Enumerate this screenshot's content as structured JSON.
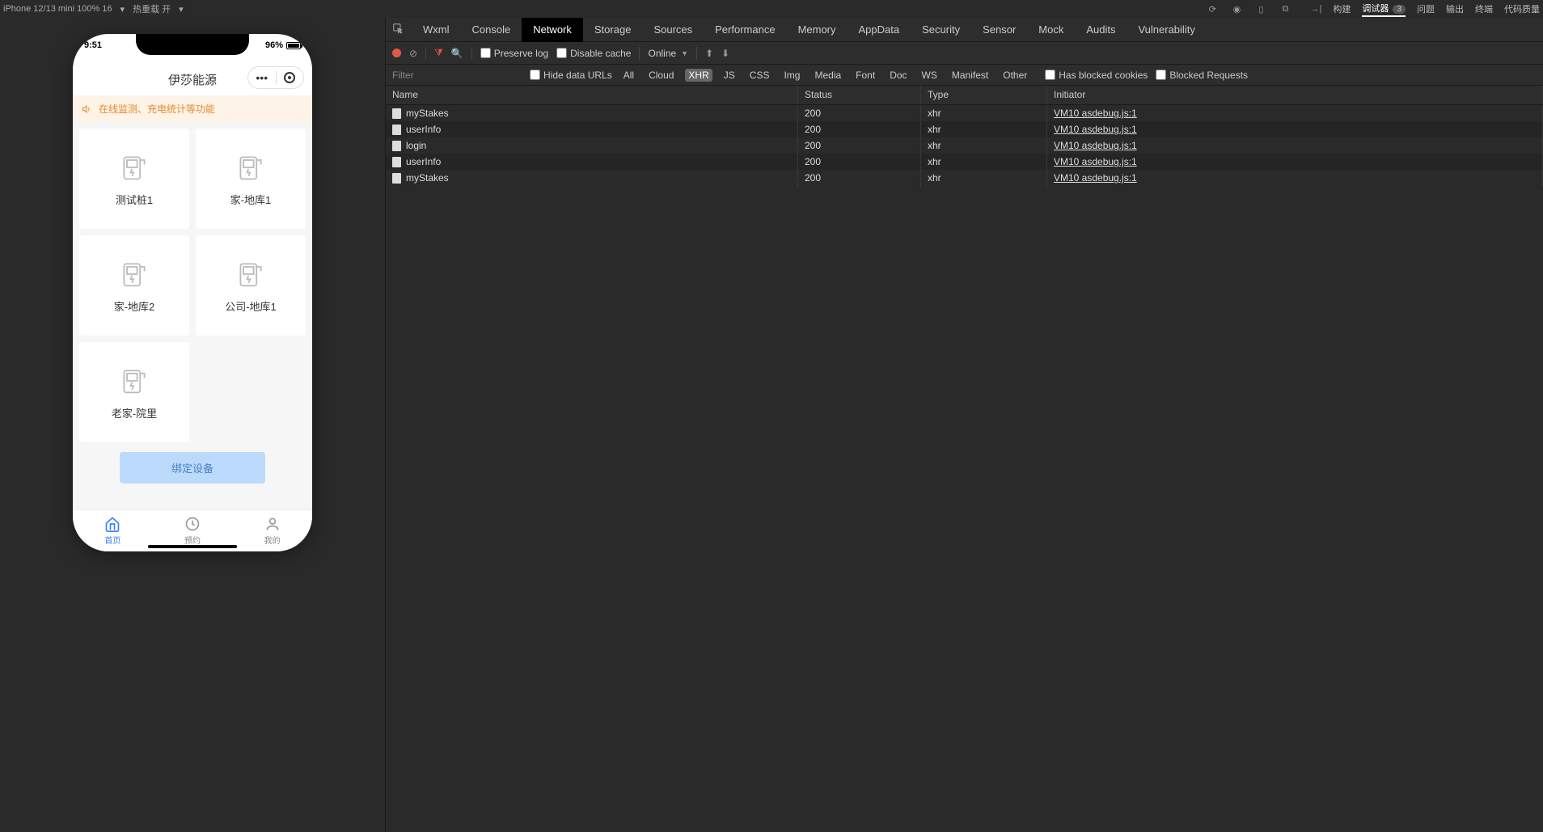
{
  "toolbar": {
    "device": "iPhone 12/13 mini 100% 16",
    "hotreload": "热重载 开",
    "tabs": [
      "构建",
      "调试器",
      "问题",
      "输出",
      "终端",
      "代码质量"
    ],
    "active_tab": "调试器",
    "badge": "3"
  },
  "phone": {
    "time": "9:51",
    "battery_pct": "96%",
    "title": "伊莎能源",
    "notice": "在线监测、充电统计等功能",
    "cards": [
      "测试桩1",
      "家-地库1",
      "家-地库2",
      "公司-地库1",
      "老家-院里"
    ],
    "bind_btn": "绑定设备",
    "tabs": [
      {
        "label": "首页",
        "active": true
      },
      {
        "label": "预约",
        "active": false
      },
      {
        "label": "我的",
        "active": false
      }
    ]
  },
  "devtools": {
    "tabs": [
      "Wxml",
      "Console",
      "Network",
      "Storage",
      "Sources",
      "Performance",
      "Memory",
      "AppData",
      "Security",
      "Sensor",
      "Mock",
      "Audits",
      "Vulnerability"
    ],
    "active_tab": "Network",
    "preserve_log": "Preserve log",
    "disable_cache": "Disable cache",
    "online": "Online",
    "filter_placeholder": "Filter",
    "hide_data_urls": "Hide data URLs",
    "has_blocked_cookies": "Has blocked cookies",
    "blocked_requests": "Blocked Requests",
    "filter_types": [
      "All",
      "Cloud",
      "XHR",
      "JS",
      "CSS",
      "Img",
      "Media",
      "Font",
      "Doc",
      "WS",
      "Manifest",
      "Other"
    ],
    "active_filter_type": "XHR",
    "columns": {
      "name": "Name",
      "status": "Status",
      "type": "Type",
      "initiator": "Initiator"
    },
    "rows": [
      {
        "name": "myStakes",
        "status": "200",
        "type": "xhr",
        "initiator": "VM10 asdebug.js:1"
      },
      {
        "name": "userInfo",
        "status": "200",
        "type": "xhr",
        "initiator": "VM10 asdebug.js:1"
      },
      {
        "name": "login",
        "status": "200",
        "type": "xhr",
        "initiator": "VM10 asdebug.js:1"
      },
      {
        "name": "userInfo",
        "status": "200",
        "type": "xhr",
        "initiator": "VM10 asdebug.js:1"
      },
      {
        "name": "myStakes",
        "status": "200",
        "type": "xhr",
        "initiator": "VM10 asdebug.js:1"
      }
    ]
  }
}
